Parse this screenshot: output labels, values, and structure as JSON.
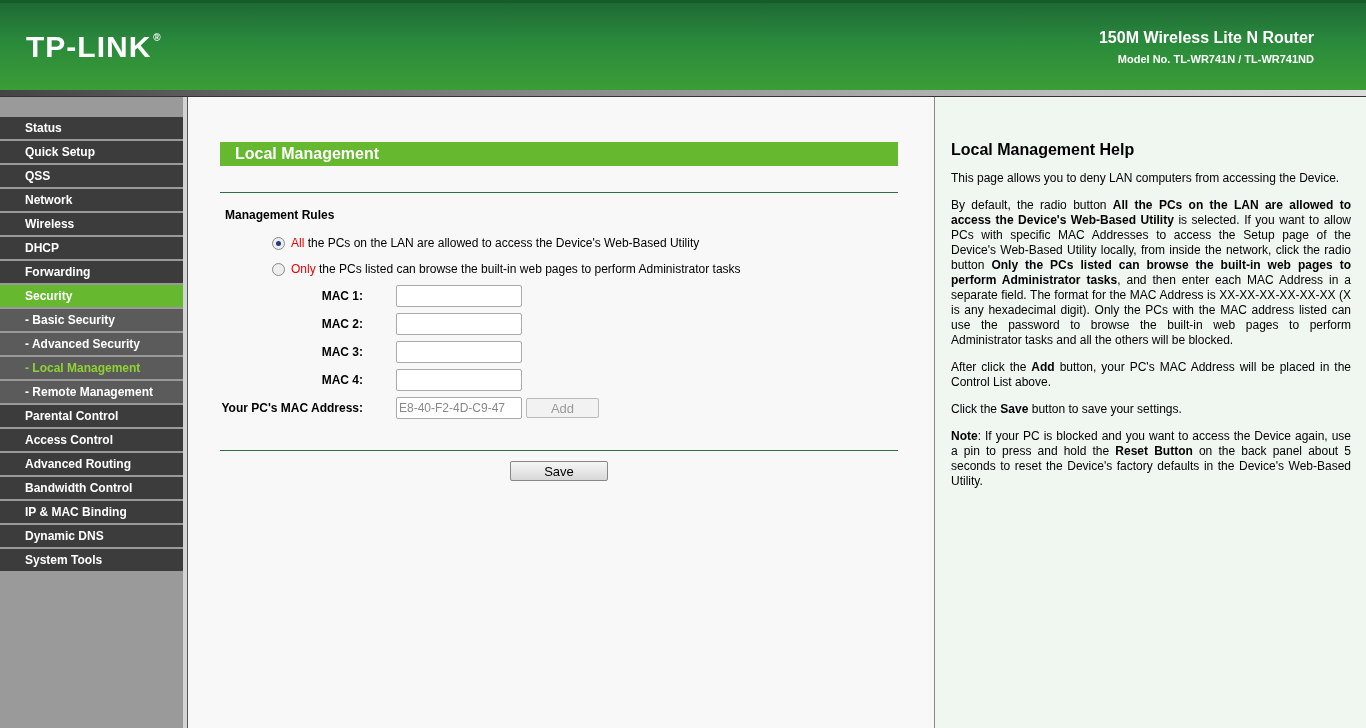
{
  "header": {
    "logo": "TP-LINK",
    "logo_mark": "®",
    "product": "150M Wireless Lite N Router",
    "model": "Model No. TL-WR741N / TL-WR741ND"
  },
  "sidebar": {
    "items": [
      {
        "label": "Status",
        "kind": "main",
        "selected": false
      },
      {
        "label": "Quick Setup",
        "kind": "main",
        "selected": false
      },
      {
        "label": "QSS",
        "kind": "main",
        "selected": false
      },
      {
        "label": "Network",
        "kind": "main",
        "selected": false
      },
      {
        "label": "Wireless",
        "kind": "main",
        "selected": false
      },
      {
        "label": "DHCP",
        "kind": "main",
        "selected": false
      },
      {
        "label": "Forwarding",
        "kind": "main",
        "selected": false
      },
      {
        "label": "Security",
        "kind": "main",
        "selected": true
      },
      {
        "label": "- Basic Security",
        "kind": "sub",
        "selected": false
      },
      {
        "label": "- Advanced Security",
        "kind": "sub",
        "selected": false
      },
      {
        "label": "- Local Management",
        "kind": "sub",
        "selected": true
      },
      {
        "label": "- Remote Management",
        "kind": "sub",
        "selected": false
      },
      {
        "label": "Parental Control",
        "kind": "main",
        "selected": false
      },
      {
        "label": "Access Control",
        "kind": "main",
        "selected": false
      },
      {
        "label": "Advanced Routing",
        "kind": "main",
        "selected": false
      },
      {
        "label": "Bandwidth Control",
        "kind": "main",
        "selected": false
      },
      {
        "label": "IP & MAC Binding",
        "kind": "main",
        "selected": false
      },
      {
        "label": "Dynamic DNS",
        "kind": "main",
        "selected": false
      },
      {
        "label": "System Tools",
        "kind": "main",
        "selected": false
      }
    ]
  },
  "main": {
    "title": "Local Management",
    "section": "Management Rules",
    "rules": [
      {
        "highlight": "All",
        "text": " the PCs on the LAN are allowed to access the Device's Web-Based Utility",
        "selected": true
      },
      {
        "highlight": "Only",
        "text": " the PCs listed can browse the built-in web pages to perform Administrator tasks",
        "selected": false
      }
    ],
    "mac_fields": [
      {
        "label": "MAC 1:"
      },
      {
        "label": "MAC 2:"
      },
      {
        "label": "MAC 3:"
      },
      {
        "label": "MAC 4:"
      }
    ],
    "pc_mac": {
      "label": "Your PC's MAC Address:",
      "value": "E8-40-F2-4D-C9-47",
      "disabled": true
    },
    "add_button": {
      "label": "Add",
      "disabled": true
    },
    "save_button": "Save"
  },
  "help": {
    "title": "Local Management Help",
    "paragraphs": [
      "This page allows you to deny LAN computers from accessing the Device.",
      "By default, the radio button **All the PCs on the LAN are allowed to access the Device's Web-Based Utility** is selected. If you want to allow PCs with specific MAC Addresses to access the Setup page of the Device's Web-Based Utility locally, from inside the network, click the radio button **Only the PCs listed can browse the built-in web pages to perform Administrator tasks**, and then enter each MAC Address in a separate field. The format for the MAC Address is XX-XX-XX-XX-XX-XX (X is any hexadecimal digit). Only the PCs with the MAC address listed can use the password to browse the built-in web pages to perform Administrator tasks and all the others will be blocked.",
      "After click the **Add** button, your PC's MAC Address will be placed in the Control List above.",
      "Click the **Save** button to save your settings.",
      "**Note**: If your PC is blocked and you want to access the Device again, use a pin to press and hold the **Reset Button** on the back panel about 5 seconds to reset the Device's factory defaults in the Device's Web-Based Utility."
    ]
  }
}
